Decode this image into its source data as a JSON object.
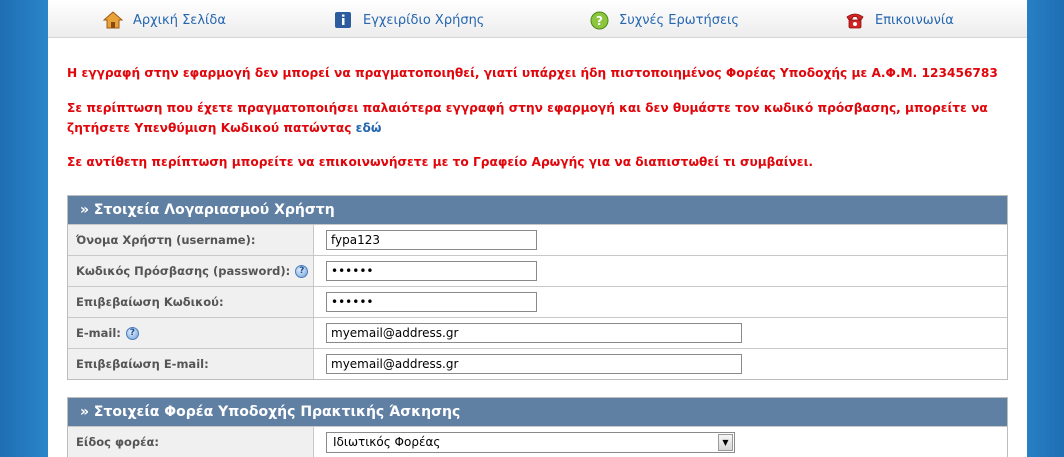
{
  "nav": {
    "home": "Αρχική Σελίδα",
    "manual": "Εγχειρίδιο Χρήσης",
    "faq": "Συχνές Ερωτήσεις",
    "contact": "Επικοινωνία"
  },
  "messages": {
    "line1": "Η εγγραφή στην εφαρμογή δεν μπορεί να πραγματοποιηθεί, γιατί υπάρχει ήδη πιστοποιημένος Φορέας Υποδοχής με Α.Φ.Μ. 123456783",
    "line2": "Σε περίπτωση που έχετε πραγματοποιήσει παλαιότερα εγγραφή στην εφαρμογή και δεν θυμάστε τον κωδικό πρόσβασης, μπορείτε να ζητήσετε Υπενθύμιση Κωδικού πατώντας",
    "line2_link": "εδώ",
    "line3": "Σε αντίθετη περίπτωση μπορείτε να επικοινωνήσετε με το Γραφείο Αρωγής για να διαπιστωθεί τι συμβαίνει."
  },
  "account": {
    "title": "» Στοιχεία Λογαριασμού Χρήστη",
    "username_label": "Όνομα Χρήστη (username):",
    "username_value": "fypa123",
    "password_label": "Κωδικός Πρόσβασης (password):",
    "password_value": "••••••",
    "confirm_label": "Επιβεβαίωση Κωδικού:",
    "confirm_value": "••••••",
    "email_label": "E-mail:",
    "email_value": "myemail@address.gr",
    "email_confirm_label": "Επιβεβαίωση E-mail:",
    "email_confirm_value": "myemail@address.gr"
  },
  "provider": {
    "title": "» Στοιχεία Φορέα Υποδοχής Πρακτικής Άσκησης",
    "type_label": "Είδος φορέα:",
    "type_value": "Ιδιωτικός Φορέας"
  },
  "colors": {
    "accent": "#2566b0",
    "error": "#e0060b",
    "header": "#5f7fa3"
  }
}
